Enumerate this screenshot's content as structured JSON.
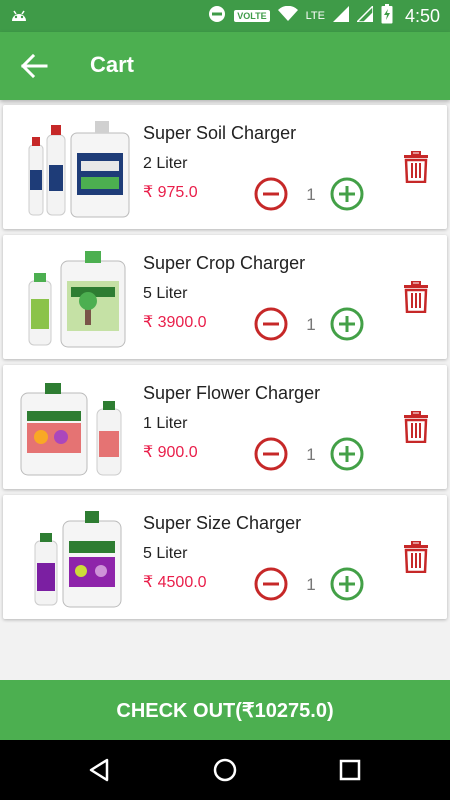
{
  "status_bar": {
    "volte": "VOLTE",
    "lte": "LTE",
    "time": "4:50"
  },
  "header": {
    "title": "Cart"
  },
  "cart_items": [
    {
      "name": "Super Soil Charger",
      "size": "2 Liter",
      "price": "₹ 975.0",
      "quantity": "1"
    },
    {
      "name": "Super Crop Charger",
      "size": "5 Liter",
      "price": "₹ 3900.0",
      "quantity": "1"
    },
    {
      "name": "Super Flower Charger",
      "size": "1 Liter",
      "price": "₹ 900.0",
      "quantity": "1"
    },
    {
      "name": "Super Size Charger",
      "size": "5 Liter",
      "price": "₹ 4500.0",
      "quantity": "1"
    }
  ],
  "checkout": {
    "label": "CHECK OUT(₹10275.0)"
  },
  "colors": {
    "primary": "#4caf50",
    "status_bar": "#3f9b48",
    "price": "#e91e4a",
    "minus": "#c62828",
    "plus": "#43a047",
    "trash": "#c62828"
  },
  "icons": [
    "android-icon",
    "block-icon",
    "wifi-icon",
    "signal-icon",
    "battery-icon",
    "back-arrow-icon",
    "minus-circle-icon",
    "plus-circle-icon",
    "trash-icon",
    "nav-back-icon",
    "nav-home-icon",
    "nav-recents-icon"
  ]
}
